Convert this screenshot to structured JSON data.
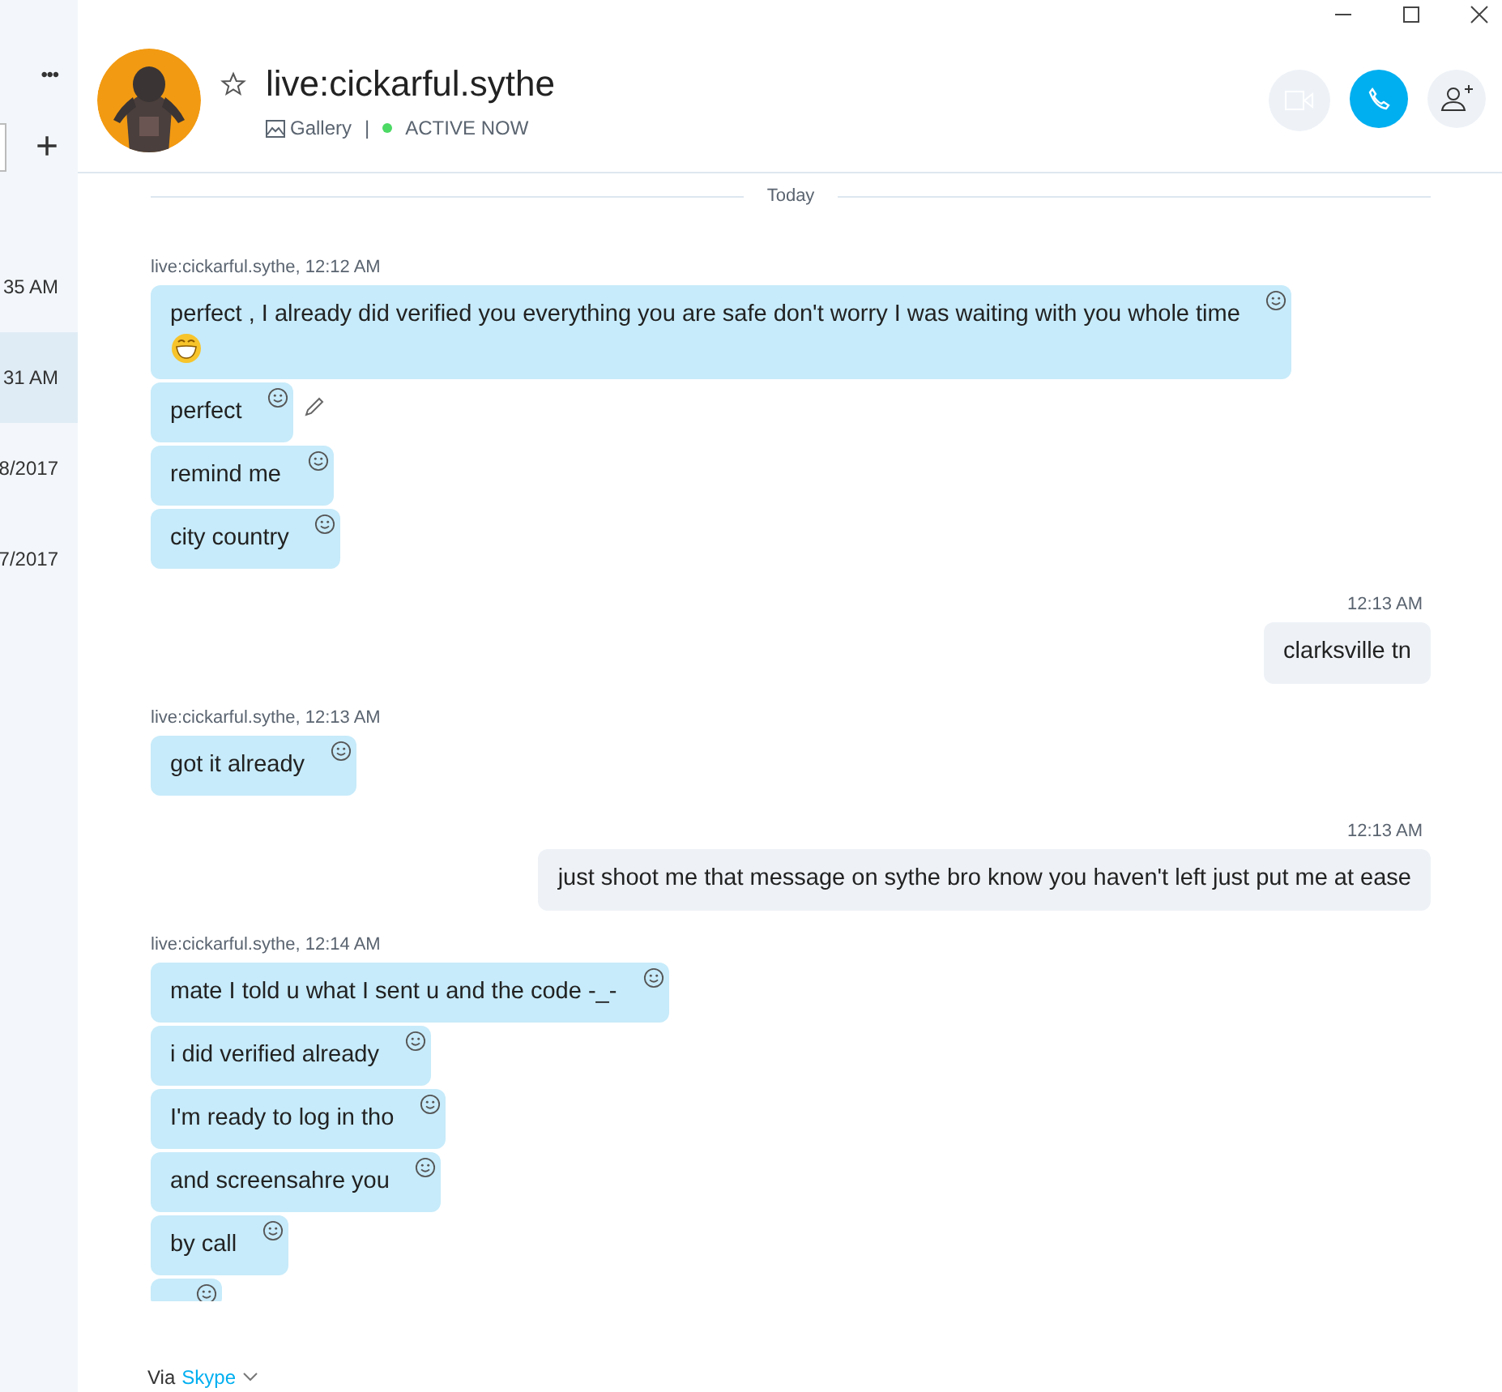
{
  "sidebar": {
    "menu": "•••",
    "add": "+",
    "items": [
      {
        "time": "35 AM",
        "selected": false
      },
      {
        "time": "31 AM",
        "selected": true
      },
      {
        "time": "8/2017",
        "selected": false
      },
      {
        "time": "7/2017",
        "selected": false
      }
    ]
  },
  "header": {
    "name": "live:cickarful.sythe",
    "gallery": "Gallery",
    "separator": "|",
    "status": "ACTIVE NOW",
    "online": true,
    "favorite": false
  },
  "chat": [
    {
      "kind": "date",
      "text": "Today"
    },
    {
      "kind": "incoming",
      "sender": "live:cickarful.sythe, 12:12 AM",
      "messages": [
        {
          "text": "perfect , I already did  verified you everything you are safe don't worry I was waiting with you whole time",
          "emoji": true,
          "editable": false
        },
        {
          "text": "perfect",
          "emoji": false,
          "editable": true
        },
        {
          "text": "remind me",
          "emoji": false,
          "editable": false
        },
        {
          "text": "city country",
          "emoji": false,
          "editable": false
        }
      ]
    },
    {
      "kind": "outgoing",
      "time": "12:13 AM",
      "text": "clarksville tn"
    },
    {
      "kind": "incoming",
      "sender": "live:cickarful.sythe, 12:13 AM",
      "messages": [
        {
          "text": "got it already",
          "emoji": false,
          "editable": false
        }
      ]
    },
    {
      "kind": "outgoing",
      "time": "12:13 AM",
      "text": "just shoot me that message on sythe bro know you haven't left just put me at ease"
    },
    {
      "kind": "incoming",
      "sender": "live:cickarful.sythe, 12:14 AM",
      "messages": [
        {
          "text": "mate I  told u what I sent u and the code -_-",
          "emoji": false,
          "editable": false
        },
        {
          "text": "i did verified already",
          "emoji": false,
          "editable": false
        },
        {
          "text": "I'm ready to log in tho",
          "emoji": false,
          "editable": false
        },
        {
          "text": "and screensahre you",
          "emoji": false,
          "editable": false
        },
        {
          "text": "by call",
          "emoji": false,
          "editable": false
        },
        {
          "emoji": false,
          "editable": false
        }
      ]
    }
  ],
  "footer": {
    "via": "Via",
    "link": "Skype"
  }
}
